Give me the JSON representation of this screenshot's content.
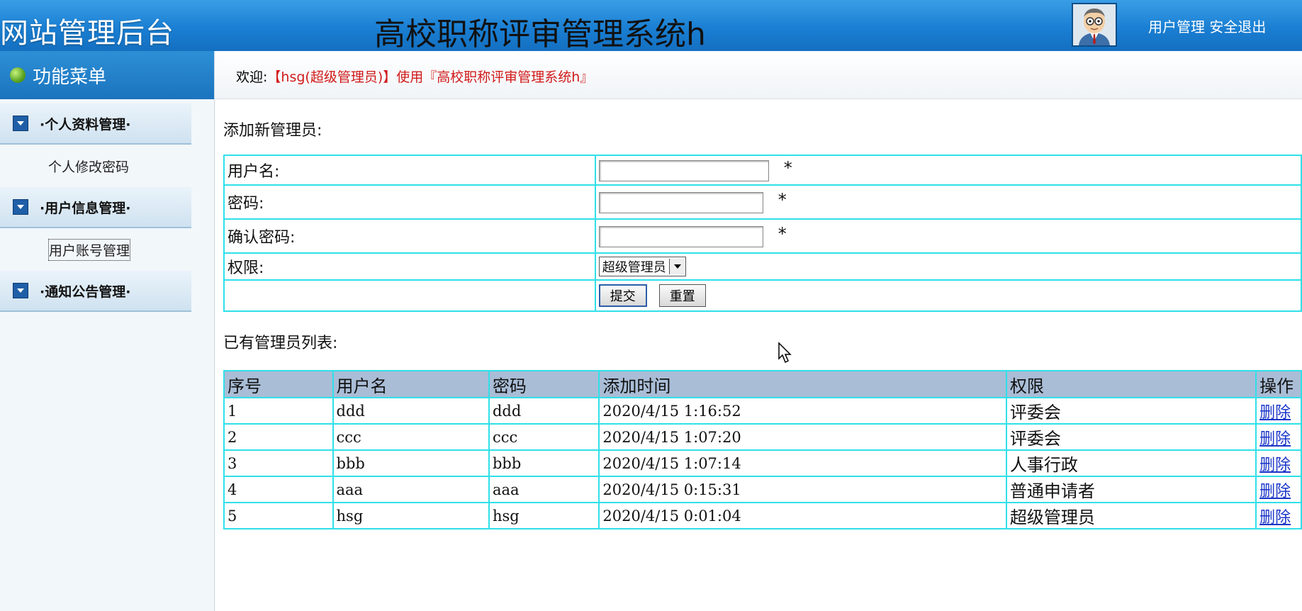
{
  "header": {
    "logo_text": "网站管理后台",
    "system_title": "高校职称评审管理系统h",
    "links": [
      "用户管理",
      "安全退出"
    ]
  },
  "sidebar": {
    "title": "功能菜单",
    "groups": [
      {
        "label": "·个人资料管理·",
        "items": [
          "个人修改密码"
        ]
      },
      {
        "label": "·用户信息管理·",
        "items": [
          "用户账号管理"
        ]
      },
      {
        "label": "·通知公告管理·",
        "items": []
      }
    ]
  },
  "welcome": {
    "prefix": "欢迎:",
    "user": "【hsg(超级管理员)】",
    "middle": "使用",
    "system": "『高校职称评审管理系统h』"
  },
  "form": {
    "section_title": "添加新管理员:",
    "username_label": "用户名:",
    "password_label": "密码:",
    "confirm_label": "确认密码:",
    "permission_label": "权限:",
    "required_mark": "*",
    "permission_selected": "超级管理员",
    "submit_label": "提交",
    "reset_label": "重置"
  },
  "list": {
    "section_title": "已有管理员列表:",
    "headers": [
      "序号",
      "用户名",
      "密码",
      "添加时间",
      "权限",
      "操作"
    ],
    "rows": [
      {
        "id": "1",
        "username": "ddd",
        "password": "ddd",
        "time": "2020/4/15 1:16:52",
        "role": "评委会",
        "action": "删除"
      },
      {
        "id": "2",
        "username": "ccc",
        "password": "ccc",
        "time": "2020/4/15 1:07:20",
        "role": "评委会",
        "action": "删除"
      },
      {
        "id": "3",
        "username": "bbb",
        "password": "bbb",
        "time": "2020/4/15 1:07:14",
        "role": "人事行政",
        "action": "删除"
      },
      {
        "id": "4",
        "username": "aaa",
        "password": "aaa",
        "time": "2020/4/15 0:15:31",
        "role": "普通申请者",
        "action": "删除"
      },
      {
        "id": "5",
        "username": "hsg",
        "password": "hsg",
        "time": "2020/4/15 0:01:04",
        "role": "超级管理员",
        "action": "删除"
      }
    ]
  }
}
